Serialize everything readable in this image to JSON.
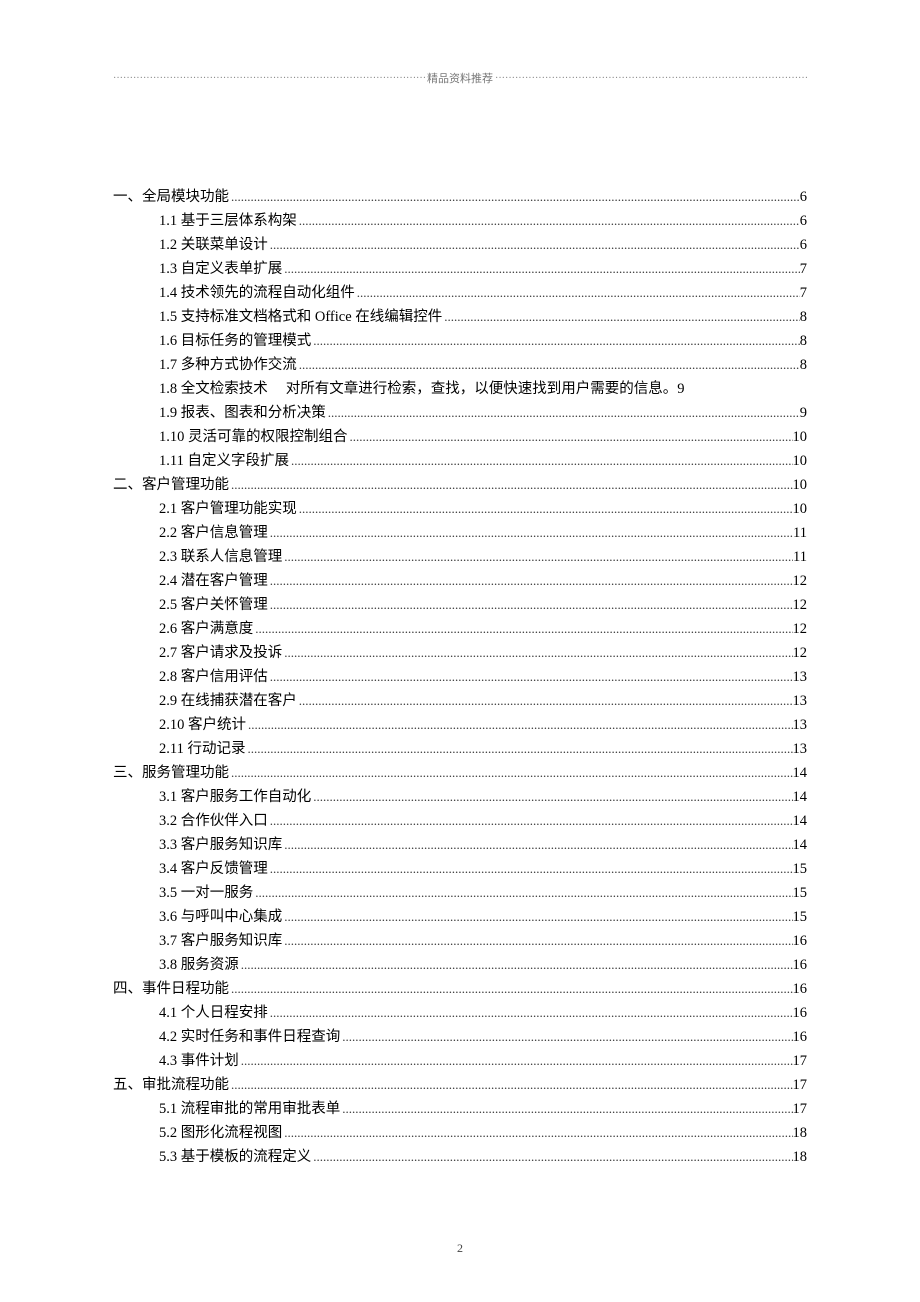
{
  "header": {
    "label": "精品资料推荐"
  },
  "toc": [
    {
      "level": 1,
      "prefix": "一、",
      "title": "全局模块功能",
      "page": "6"
    },
    {
      "level": 2,
      "prefix": "",
      "title": "1.1 基于三层体系构架",
      "page": "6"
    },
    {
      "level": 2,
      "prefix": "",
      "title": "1.2 关联菜单设计",
      "page": "6"
    },
    {
      "level": 2,
      "prefix": "",
      "title": "1.3 自定义表单扩展",
      "page": "7"
    },
    {
      "level": 2,
      "prefix": "",
      "title": "1.4 技术领先的流程自动化组件",
      "page": "7"
    },
    {
      "level": 2,
      "prefix": "",
      "title": "1.5 支持标准文档格式和 Office 在线编辑控件",
      "page": "8"
    },
    {
      "level": 2,
      "prefix": "",
      "title": "1.6 目标任务的管理模式",
      "page": "8"
    },
    {
      "level": 2,
      "prefix": "",
      "title": "1.7 多种方式协作交流",
      "page": "8"
    },
    {
      "level": 2,
      "prefix": "",
      "title": "1.8 全文检索技术",
      "note": "对所有文章进行检索，查找，以便快速找到用户需要的信息。",
      "page": "9",
      "noleader": true
    },
    {
      "level": 2,
      "prefix": "",
      "title": "1.9 报表、图表和分析决策",
      "page": "9"
    },
    {
      "level": 2,
      "prefix": "",
      "title": "1.10 灵活可靠的权限控制组合",
      "page": "10"
    },
    {
      "level": 2,
      "prefix": "",
      "title": "1.11 自定义字段扩展",
      "page": "10"
    },
    {
      "level": 1,
      "prefix": "二、",
      "title": "客户管理功能",
      "page": "10"
    },
    {
      "level": 2,
      "prefix": "",
      "title": "2.1 客户管理功能实现",
      "page": "10"
    },
    {
      "level": 2,
      "prefix": "",
      "title": "2.2 客户信息管理",
      "page": "11"
    },
    {
      "level": 2,
      "prefix": "",
      "title": "2.3 联系人信息管理",
      "page": "11"
    },
    {
      "level": 2,
      "prefix": "",
      "title": "2.4 潜在客户管理",
      "page": "12"
    },
    {
      "level": 2,
      "prefix": "",
      "title": "2.5 客户关怀管理",
      "page": "12"
    },
    {
      "level": 2,
      "prefix": "",
      "title": "2.6 客户满意度",
      "page": "12"
    },
    {
      "level": 2,
      "prefix": "",
      "title": "2.7 客户请求及投诉",
      "page": "12"
    },
    {
      "level": 2,
      "prefix": "",
      "title": "2.8 客户信用评估",
      "page": "13"
    },
    {
      "level": 2,
      "prefix": "",
      "title": "2.9 在线捕获潜在客户",
      "page": "13"
    },
    {
      "level": 2,
      "prefix": "",
      "title": "2.10 客户统计",
      "page": "13"
    },
    {
      "level": 2,
      "prefix": "",
      "title": "2.11 行动记录",
      "page": "13"
    },
    {
      "level": 1,
      "prefix": "三、",
      "title": "服务管理功能",
      "page": "14"
    },
    {
      "level": 2,
      "prefix": "",
      "title": "3.1 客户服务工作自动化",
      "page": "14"
    },
    {
      "level": 2,
      "prefix": "",
      "title": "3.2 合作伙伴入口",
      "page": "14"
    },
    {
      "level": 2,
      "prefix": "",
      "title": "3.3 客户服务知识库",
      "page": "14"
    },
    {
      "level": 2,
      "prefix": "",
      "title": "3.4 客户反馈管理",
      "page": "15"
    },
    {
      "level": 2,
      "prefix": "",
      "title": "3.5 一对一服务",
      "page": "15"
    },
    {
      "level": 2,
      "prefix": "",
      "title": "3.6 与呼叫中心集成",
      "page": "15"
    },
    {
      "level": 2,
      "prefix": "",
      "title": "3.7 客户服务知识库",
      "page": "16"
    },
    {
      "level": 2,
      "prefix": "",
      "title": "3.8 服务资源",
      "page": "16"
    },
    {
      "level": 1,
      "prefix": "四、",
      "title": "事件日程功能",
      "page": "16"
    },
    {
      "level": 2,
      "prefix": "",
      "title": "4.1 个人日程安排",
      "page": "16"
    },
    {
      "level": 2,
      "prefix": "",
      "title": "4.2 实时任务和事件日程查询",
      "page": "16"
    },
    {
      "level": 2,
      "prefix": "",
      "title": "4.3 事件计划",
      "page": "17"
    },
    {
      "level": 1,
      "prefix": "五、",
      "title": "审批流程功能",
      "page": "17"
    },
    {
      "level": 2,
      "prefix": "",
      "title": "5.1 流程审批的常用审批表单",
      "page": "17"
    },
    {
      "level": 2,
      "prefix": "",
      "title": "5.2 图形化流程视图",
      "page": "18"
    },
    {
      "level": 2,
      "prefix": "",
      "title": "5.3 基于模板的流程定义",
      "page": "18"
    }
  ],
  "pageNumber": "2"
}
